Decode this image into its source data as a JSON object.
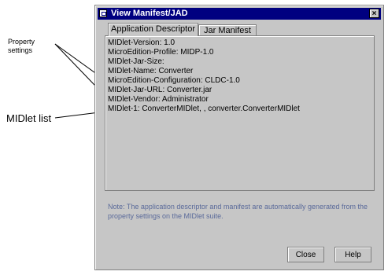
{
  "annotations": {
    "property_settings": "Property\nsettings",
    "midlet_list": "MIDlet list"
  },
  "dialog": {
    "title": "View Manifest/JAD",
    "close_glyph": "×",
    "tabs": [
      {
        "label": "Application Descriptor",
        "active": true
      },
      {
        "label": "Jar Manifest",
        "active": false
      }
    ],
    "content_lines": [
      "MIDlet-Version: 1.0",
      "MicroEdition-Profile: MIDP-1.0",
      "MIDlet-Jar-Size:",
      "MIDlet-Name: Converter",
      "MicroEdition-Configuration: CLDC-1.0",
      "MIDlet-Jar-URL: Converter.jar",
      "MIDlet-Vendor: Administrator",
      "MIDlet-1: ConverterMIDlet, , converter.ConverterMIDlet"
    ],
    "note": "Note: The application descriptor and manifest are automatically generated from the property settings on the MIDlet suite.",
    "buttons": {
      "close": "Close",
      "help": "Help"
    }
  },
  "colors": {
    "title_bar": "#000080",
    "dialog_bg": "#c6c6c6",
    "note_text": "#5a6a9a"
  }
}
